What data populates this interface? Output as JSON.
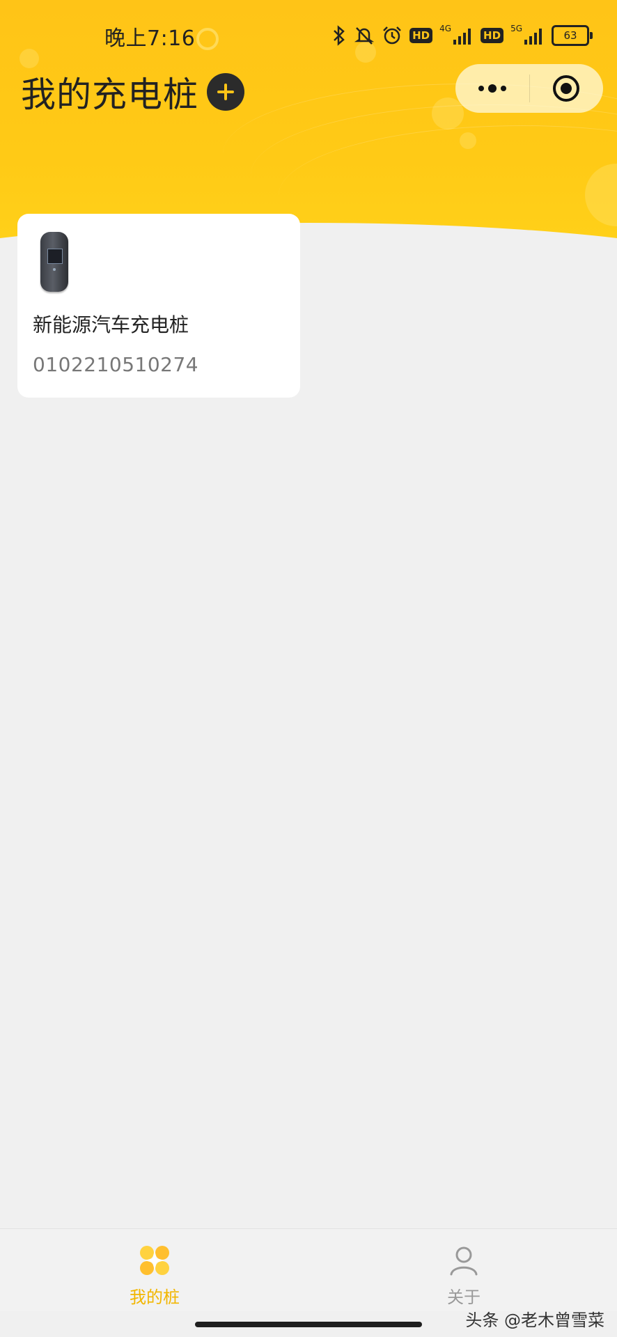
{
  "status_bar": {
    "time": "晚上7:16",
    "hd1": "HD",
    "net1": "4G",
    "hd2": "HD",
    "net2": "5G",
    "battery": "63"
  },
  "header": {
    "title": "我的充电桩",
    "add_icon": "plus-icon"
  },
  "capsule": {
    "more_icon": "more-icon",
    "close_icon": "target-icon"
  },
  "devices": [
    {
      "name": "新能源汽车充电桩",
      "code": "0102210510274",
      "image": "charger-device-image"
    }
  ],
  "tabbar": {
    "tabs": [
      {
        "label": "我的桩",
        "icon": "my-piles-icon",
        "active": true,
        "color": "#f2b600"
      },
      {
        "label": "关于",
        "icon": "person-icon",
        "active": false,
        "color": "#999999"
      }
    ]
  },
  "watermark": "头条 @老木曾雪菜",
  "colors": {
    "accent": "#ffc417",
    "background": "#f0f0f0"
  }
}
